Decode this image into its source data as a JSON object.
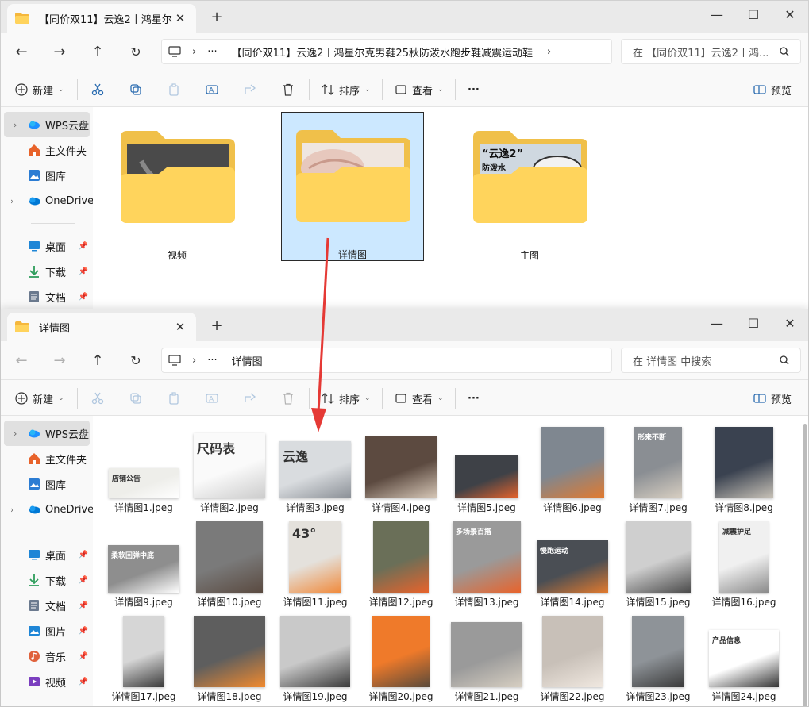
{
  "window1": {
    "tab_title": "【同价双11】云逸2丨鸿星尔克",
    "address_text": "【同价双11】云逸2丨鸿星尔克男鞋25秋防泼水跑步鞋减震运动鞋",
    "search_placeholder": "在 【同价双11】云逸2丨鸿...",
    "folders": [
      {
        "label": "视频",
        "thumb": "#5a5a5a",
        "selected": false
      },
      {
        "label": "详情图",
        "thumb": "#e9d4cc",
        "selected": true
      },
      {
        "label": "主图",
        "thumb": "#cfd8e0",
        "selected": false
      }
    ],
    "folder3_text1": "“云逸2”",
    "folder3_text2": "防泼水"
  },
  "window2": {
    "tab_title": "详情图",
    "address_text": "详情图",
    "search_placeholder": "在 详情图 中搜索"
  },
  "toolbar": {
    "new_label": "新建",
    "sort_label": "排序",
    "view_label": "查看",
    "more_label": "···",
    "preview_label": "预览"
  },
  "sidebar": {
    "items": [
      {
        "label": "WPS云盘",
        "icon": "cloud-icon",
        "color": "#1e90ff"
      },
      {
        "label": "主文件夹",
        "icon": "home-icon",
        "color": "#e8632b"
      },
      {
        "label": "图库",
        "icon": "gallery-icon",
        "color": "#2b7cd3"
      },
      {
        "label": "OneDrive",
        "icon": "onedrive-icon",
        "color": "#0078d4"
      },
      {
        "label": "桌面",
        "icon": "desktop-icon",
        "color": "#1f86d6"
      },
      {
        "label": "下载",
        "icon": "download-icon",
        "color": "#2d9d5b"
      },
      {
        "label": "文档",
        "icon": "document-icon",
        "color": "#6b7a8f"
      },
      {
        "label": "图片",
        "icon": "pictures-icon",
        "color": "#1f86d6"
      },
      {
        "label": "音乐",
        "icon": "music-icon",
        "color": "#e0623c"
      },
      {
        "label": "视频",
        "icon": "video-icon",
        "color": "#7b3fbf"
      }
    ]
  },
  "files": [
    {
      "name": "详情图1.jpeg",
      "bg": "#eeeeea",
      "accent": "#ffffff",
      "text": "店铺公告"
    },
    {
      "name": "详情图2.jpeg",
      "bg": "#fafafa",
      "accent": "#cccccc",
      "text": "尺码表"
    },
    {
      "name": "详情图3.jpeg",
      "bg": "#d9dcdf",
      "accent": "#8a8f96",
      "text": "云逸"
    },
    {
      "name": "详情图4.jpeg",
      "bg": "#5c4a40",
      "accent": "#d7c8b8",
      "text": ""
    },
    {
      "name": "详情图5.jpeg",
      "bg": "#3e4147",
      "accent": "#e8632b",
      "text": ""
    },
    {
      "name": "详情图6.jpeg",
      "bg": "#7f8790",
      "accent": "#e27a2e",
      "text": ""
    },
    {
      "name": "详情图7.jpeg",
      "bg": "#8a8e93",
      "accent": "#d8cfc2",
      "text": "形来不断"
    },
    {
      "name": "详情图8.jpeg",
      "bg": "#3a4250",
      "accent": "#c9c3b8",
      "text": ""
    },
    {
      "name": "详情图9.jpeg",
      "bg": "#8e8e8e",
      "accent": "#ffffff",
      "text": "柔软回弹中底"
    },
    {
      "name": "详情图10.jpeg",
      "bg": "#7a7a7a",
      "accent": "#5a4a40",
      "text": ""
    },
    {
      "name": "详情图11.jpeg",
      "bg": "#e4e1dc",
      "accent": "#f08a3c",
      "text": "43°"
    },
    {
      "name": "详情图12.jpeg",
      "bg": "#6a6f58",
      "accent": "#e8632b",
      "text": ""
    },
    {
      "name": "详情图13.jpeg",
      "bg": "#9a9a9a",
      "accent": "#e8632b",
      "text": "多场景百搭"
    },
    {
      "name": "详情图14.jpeg",
      "bg": "#4a4e54",
      "accent": "#e27a2e",
      "text": "慢跑运动"
    },
    {
      "name": "详情图15.jpeg",
      "bg": "#cfcfcf",
      "accent": "#4a4a4a",
      "text": ""
    },
    {
      "name": "详情图16.jpeg",
      "bg": "#f0f0f0",
      "accent": "#8a8a8a",
      "text": "减震护足"
    },
    {
      "name": "详情图17.jpeg",
      "bg": "#d6d6d6",
      "accent": "#3a3a3a",
      "text": ""
    },
    {
      "name": "详情图18.jpeg",
      "bg": "#5e5e5e",
      "accent": "#f28a2e",
      "text": ""
    },
    {
      "name": "详情图19.jpeg",
      "bg": "#c9c9c9",
      "accent": "#3a3a3a",
      "text": ""
    },
    {
      "name": "详情图20.jpeg",
      "bg": "#ef7a2a",
      "accent": "#5a4a3a",
      "text": ""
    },
    {
      "name": "详情图21.jpeg",
      "bg": "#9a9a9a",
      "accent": "#d7cfc2",
      "text": ""
    },
    {
      "name": "详情图22.jpeg",
      "bg": "#c8c0b8",
      "accent": "#f0e8e0",
      "text": ""
    },
    {
      "name": "详情图23.jpeg",
      "bg": "#8e9398",
      "accent": "#3a3a3a",
      "text": ""
    },
    {
      "name": "详情图24.jpeg",
      "bg": "#ffffff",
      "accent": "#333333",
      "text": "产品信息"
    }
  ],
  "colors": {
    "selection": "#cce8ff",
    "folder_back": "#f0c04a",
    "folder_front": "#ffd45c",
    "arrow": "#e53935"
  }
}
